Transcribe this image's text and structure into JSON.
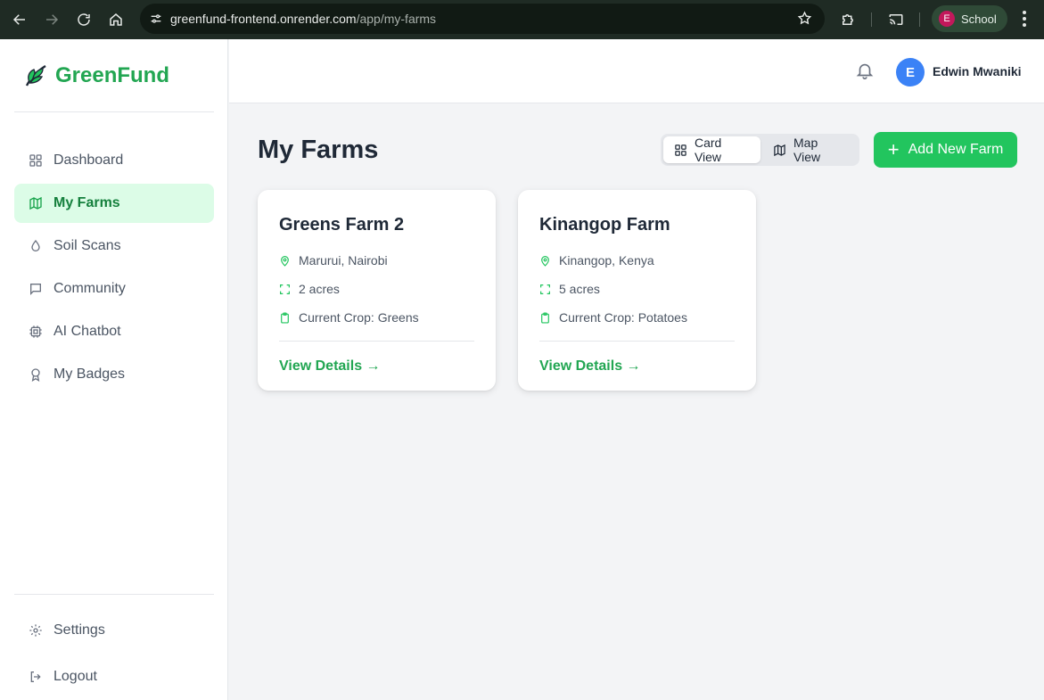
{
  "browser": {
    "url_host": "greenfund-frontend.onrender.com",
    "url_path": "/app/my-farms",
    "profile_initial": "E",
    "profile_name": "School"
  },
  "brand": {
    "name": "GreenFund"
  },
  "sidebar": {
    "items": [
      {
        "label": "Dashboard",
        "icon": "grid-icon"
      },
      {
        "label": "My Farms",
        "icon": "map-icon",
        "active": true
      },
      {
        "label": "Soil Scans",
        "icon": "droplet-icon"
      },
      {
        "label": "Community",
        "icon": "message-square-icon"
      },
      {
        "label": "AI Chatbot",
        "icon": "cpu-icon"
      },
      {
        "label": "My Badges",
        "icon": "award-icon"
      }
    ],
    "bottom": [
      {
        "label": "Settings",
        "icon": "gear-icon"
      },
      {
        "label": "Logout",
        "icon": "logout-icon"
      }
    ]
  },
  "header": {
    "user_initial": "E",
    "user_name": "Edwin Mwaniki"
  },
  "main": {
    "title": "My Farms",
    "view_toggle": {
      "card": "Card View",
      "map": "Map View",
      "selected": "Card View"
    },
    "add_button": "Add New Farm",
    "farms": [
      {
        "name": "Greens Farm 2",
        "location": "Marurui, Nairobi",
        "size": "2 acres",
        "crop": "Current Crop: Greens",
        "link": "View Details →"
      },
      {
        "name": "Kinangop Farm",
        "location": "Kinangop, Kenya",
        "size": "5 acres",
        "crop": "Current Crop: Potatoes",
        "link": "View Details →"
      }
    ]
  },
  "colors": {
    "accent": "#22c55e",
    "brand_text": "#22a652",
    "active_bg": "#dcfce7",
    "avatar": "#3b82f6"
  }
}
